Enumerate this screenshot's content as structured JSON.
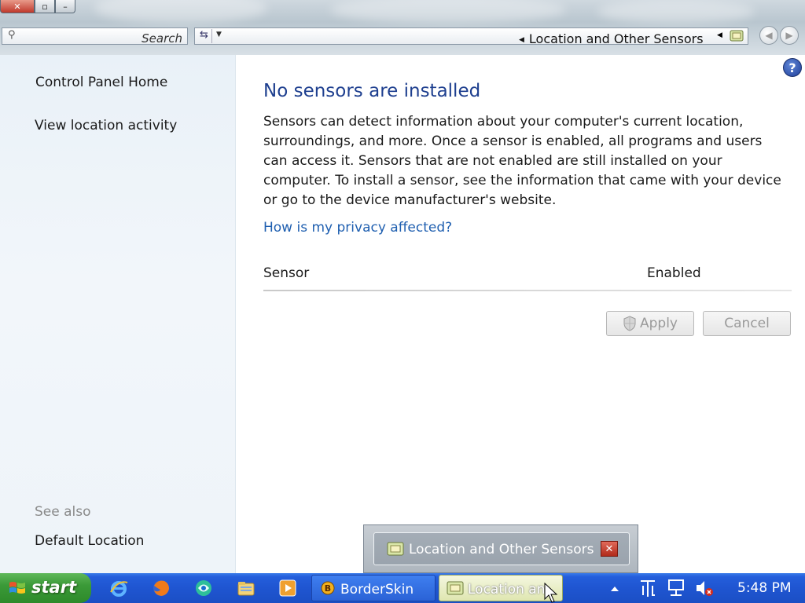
{
  "window": {
    "controls": {
      "close": "✕",
      "restore": "▫",
      "minimize": "–"
    },
    "search_placeholder": "Search",
    "breadcrumb": "Location and Other Sensors"
  },
  "sidebar": {
    "home_link": "Control Panel Home",
    "activity_link": "View location activity",
    "see_also_label": "See also",
    "default_location_link": "Default Location"
  },
  "main": {
    "title": "No sensors are installed",
    "description": "Sensors can detect information about your computer's current location, surroundings, and more. Once a sensor is enabled, all programs and users can access it. Sensors that are not enabled are still installed on your computer. To install a sensor, see the information that came with your device or go to the device manufacturer's website.",
    "privacy_link": "How is my privacy affected?",
    "table_headers": {
      "sensor": "Sensor",
      "enabled": "Enabled"
    },
    "apply_label": "Apply",
    "cancel_label": "Cancel",
    "help_icon_text": "?"
  },
  "preview": {
    "title": "Location and Other Sensors",
    "close_text": "✕"
  },
  "taskbar": {
    "start_label": "start",
    "tasks": [
      {
        "label": "BorderSkin"
      },
      {
        "label": "Location an"
      }
    ],
    "clock": "5:48 PM"
  },
  "colors": {
    "title_blue": "#1e3f8f",
    "link_blue": "#1f5fb0",
    "taskbar_blue": "#245edb",
    "start_green": "#3b9a38"
  },
  "icons": [
    "search-icon",
    "refresh-icon",
    "location-sensor-icon",
    "help-icon",
    "shield-icon",
    "windows-flag-icon",
    "internet-explorer-icon",
    "firefox-icon",
    "browser-icon",
    "folder-icon",
    "media-player-icon",
    "borderskin-icon",
    "volume-muted-icon",
    "network-icon",
    "ime-icon"
  ]
}
